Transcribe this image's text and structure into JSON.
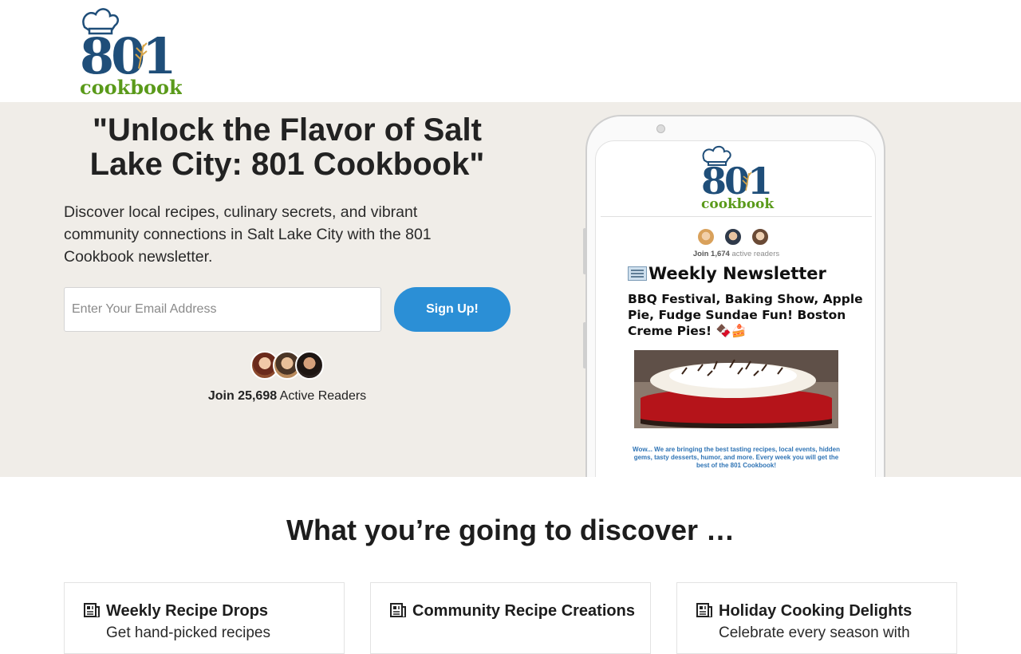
{
  "logo": {
    "number": "801",
    "word": "cookbook"
  },
  "hero": {
    "title": "\"Unlock the Flavor of Salt Lake City: 801 Cookbook\"",
    "subtitle": "Discover local recipes, culinary secrets, and vibrant community connections in Salt Lake City with the 801 Cookbook newsletter.",
    "email_placeholder": "Enter Your Email Address",
    "signup_label": "Sign Up!",
    "readers_prefix": "Join ",
    "readers_count": "25,698",
    "readers_suffix": " Active Readers"
  },
  "preview": {
    "join_prefix": "Join ",
    "join_count": "1,674",
    "join_suffix": " active readers",
    "newsletter_title": "Weekly Newsletter",
    "headline": "BBQ Festival, Baking Show, Apple Pie, Fudge Sundae Fun! Boston Creme Pies! 🍫🍰",
    "blurb": "Wow... We are bringing  the best tasting recipes, local events, hidden gems, tasty desserts, humor, and more. Every week you will get the best of the 801 Cookbook!"
  },
  "discover": {
    "title": "What you’re going to discover …",
    "cards": [
      {
        "title": "Weekly Recipe Drops",
        "text": "Get hand-picked recipes",
        "icon": "newspaper-icon"
      },
      {
        "title": "Community Recipe Creations",
        "text": "",
        "icon": "newspaper-icon"
      },
      {
        "title": "Holiday Cooking Delights",
        "text": "Celebrate every season with",
        "icon": "newspaper-icon"
      }
    ]
  },
  "colors": {
    "brand_blue": "#1f4e79",
    "brand_green": "#5a9a1a",
    "button_blue": "#2b8fd6",
    "hero_bg": "#f0ede8"
  }
}
